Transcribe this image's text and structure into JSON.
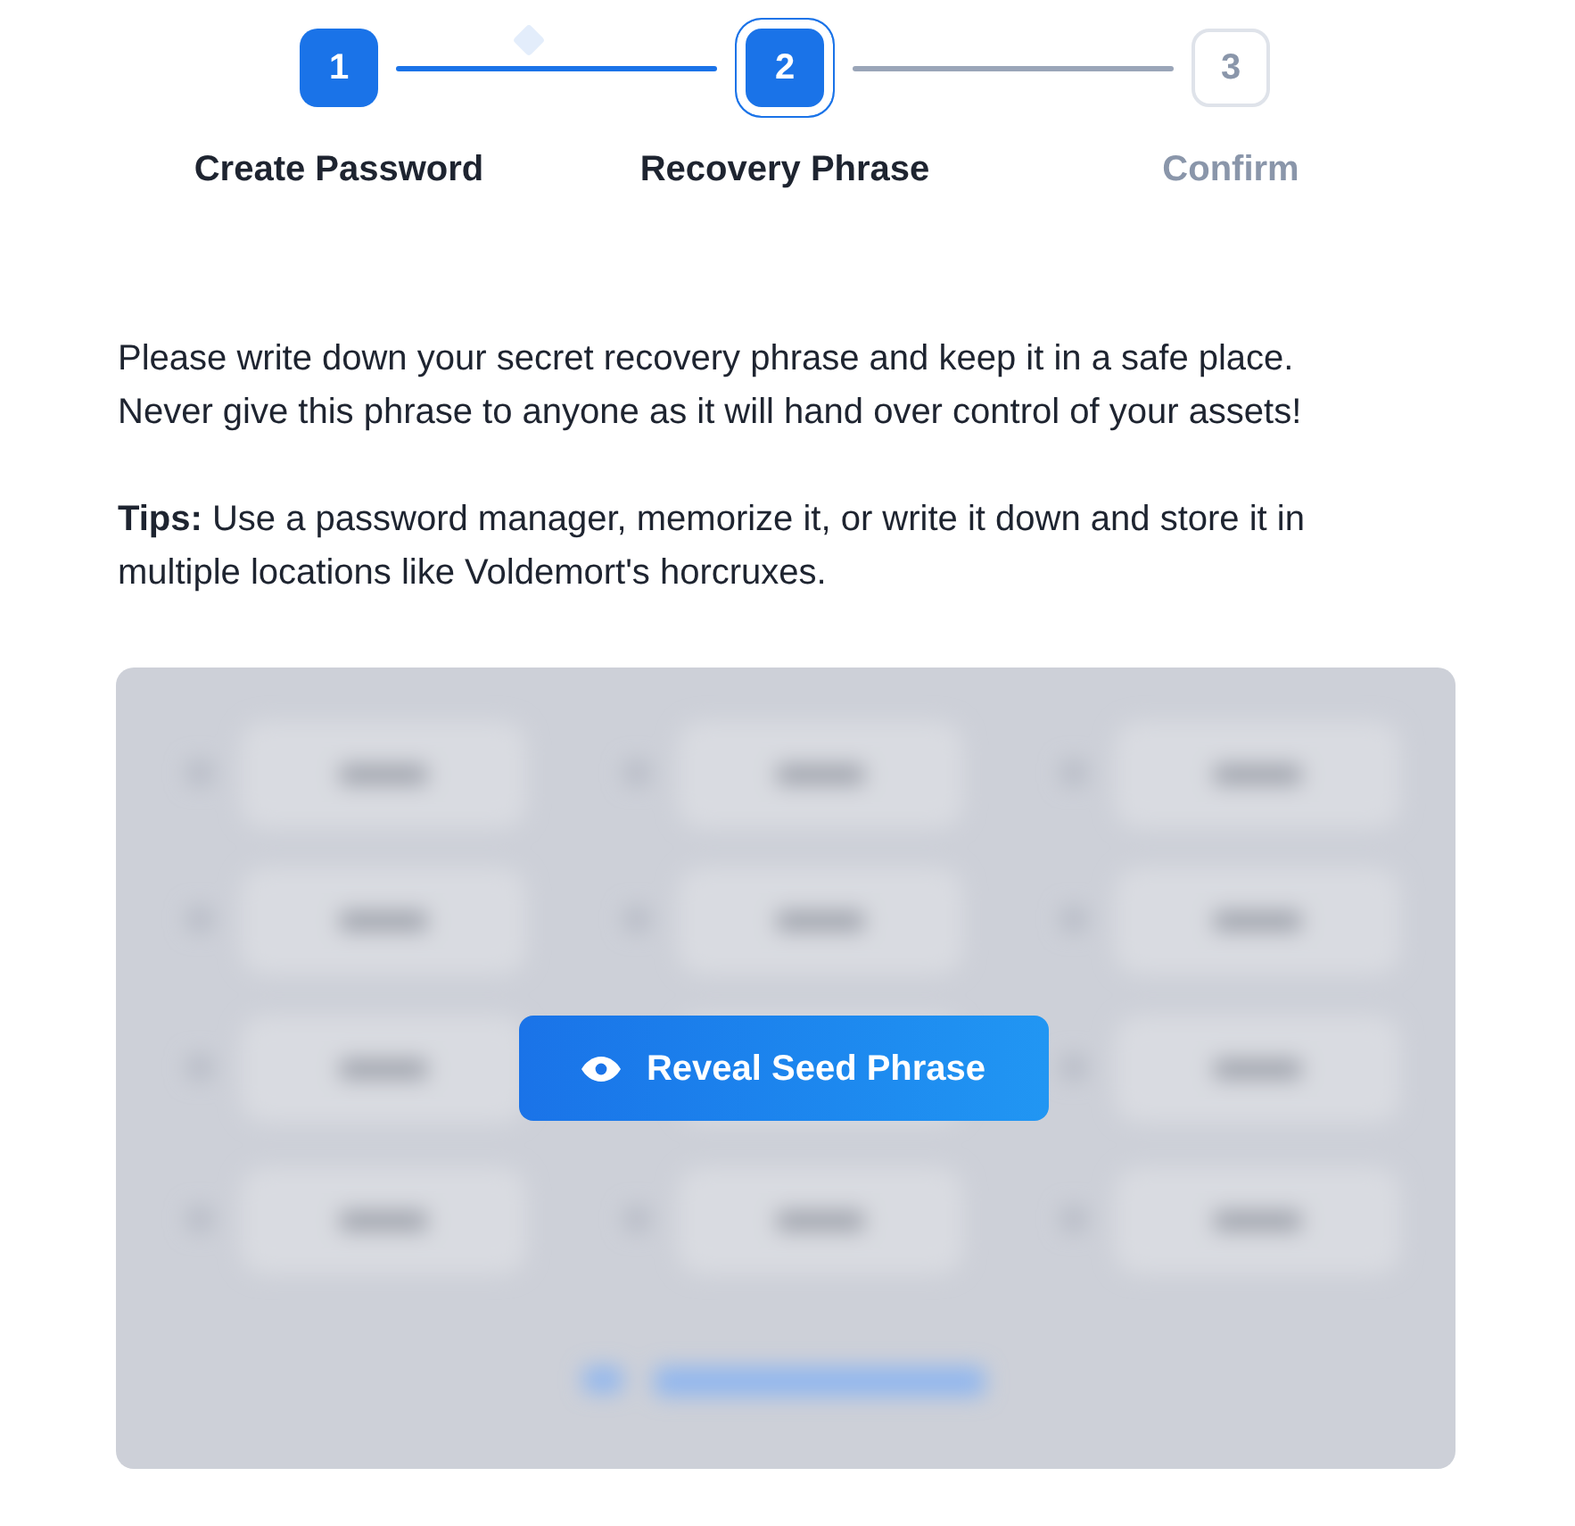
{
  "steps": [
    {
      "number": "1",
      "label": "Create Password",
      "completed": true,
      "selected": false
    },
    {
      "number": "2",
      "label": "Recovery Phrase",
      "completed": false,
      "selected": true
    },
    {
      "number": "3",
      "label": "Confirm",
      "completed": false,
      "selected": false
    }
  ],
  "instructions": [
    "Please write down your secret recovery phrase and keep it in a safe place. Never give this phrase to anyone as it will hand over control of your assets!",
    "**Tips:** Use a password manager, memorize it, or write it down and store it in multiple locations like Voldemort's horcruxes."
  ],
  "seed_panel": {
    "hidden": true,
    "reveal_button": "Reveal Seed Phrase"
  }
}
